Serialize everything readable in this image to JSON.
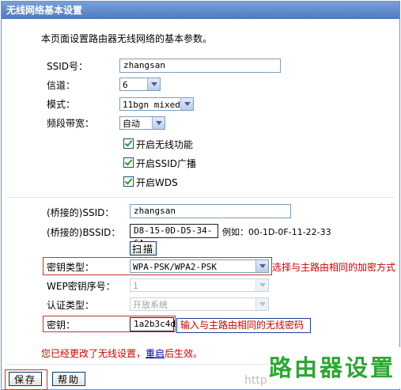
{
  "title": "无线网络基本设置",
  "intro": "本页面设置路由器无线网络的基本参数。",
  "fields": {
    "ssid_label": "SSID号：",
    "ssid_value": "zhangsan",
    "channel_label": "信道：",
    "channel_value": "6",
    "mode_label": "模式：",
    "mode_value": "11bgn mixed",
    "bandwidth_label": "频段带宽：",
    "bandwidth_value": "自动"
  },
  "checkboxes": [
    {
      "label": "开启无线功能",
      "checked": true
    },
    {
      "label": "开启SSID广播",
      "checked": true
    },
    {
      "label": "开启WDS",
      "checked": true
    }
  ],
  "wds": {
    "bridge_ssid_label": "(桥接的)SSID：",
    "bridge_ssid_value": "zhangsan",
    "bridge_bssid_label": "(桥接的)BSSID：",
    "bridge_bssid_value": "D8-15-0D-D5-34-6A",
    "bssid_example": "例如：00-1D-0F-11-22-33",
    "scan_button": "扫描",
    "key_type_label": "密钥类型：",
    "key_type_value": "WPA-PSK/WPA2-PSK",
    "key_type_note": "选择与主路由相同的加密方式",
    "wep_index_label": "WEP密钥序号：",
    "wep_index_value": "1",
    "auth_type_label": "认证类型：",
    "auth_type_value": "开放系统",
    "key_label": "密钥：",
    "key_value": "1a2b3c4d",
    "key_note": "输入与主路由相同的无线密码"
  },
  "notice": {
    "before": "您已经更改了无线设置，",
    "link": "重启",
    "after": "后生效。"
  },
  "buttons": {
    "save": "保存",
    "help": "帮助"
  },
  "watermark": {
    "http": "http",
    "text": "路由器设置"
  },
  "colors": {
    "title_bar": "#5a83c4",
    "annotation_red": "#c00000",
    "watermark_green": "#2aa830"
  }
}
